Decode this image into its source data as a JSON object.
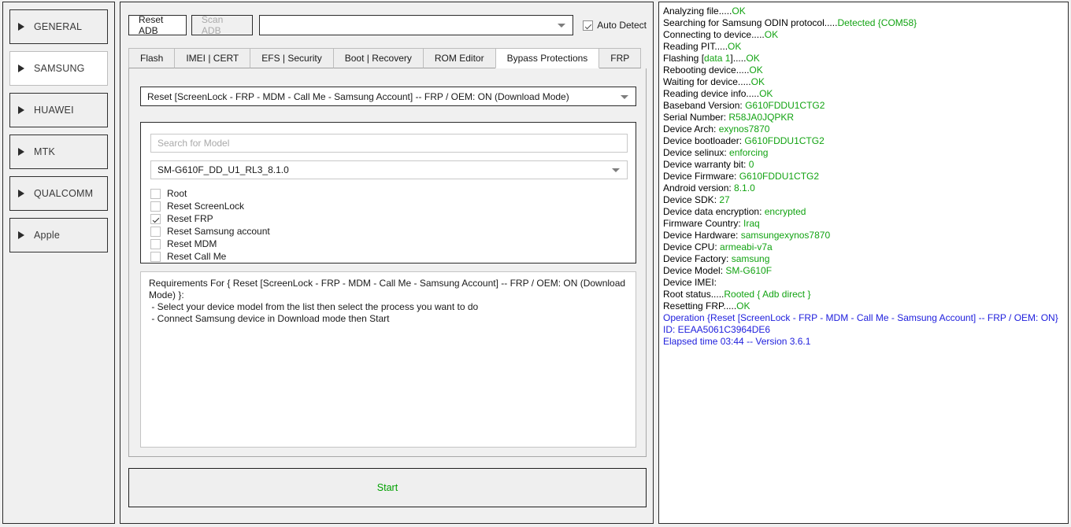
{
  "sidebar": {
    "items": [
      {
        "label": "GENERAL",
        "selected": false
      },
      {
        "label": "SAMSUNG",
        "selected": true
      },
      {
        "label": "HUAWEI",
        "selected": false
      },
      {
        "label": "MTK",
        "selected": false
      },
      {
        "label": "QUALCOMM",
        "selected": false
      },
      {
        "label": "Apple",
        "selected": false
      }
    ]
  },
  "toolbar": {
    "reset_adb_label": "Reset ADB",
    "scan_adb_label": "Scan ADB",
    "device_combo_value": "",
    "auto_detect_label": "Auto Detect",
    "auto_detect_checked": true
  },
  "tabs": [
    {
      "label": "Flash",
      "active": false
    },
    {
      "label": "IMEI | CERT",
      "active": false
    },
    {
      "label": "EFS | Security",
      "active": false
    },
    {
      "label": "Boot | Recovery",
      "active": false
    },
    {
      "label": "ROM Editor",
      "active": false
    },
    {
      "label": "Bypass Protections",
      "active": true
    },
    {
      "label": "FRP",
      "active": false
    }
  ],
  "panel": {
    "operation_value": "Reset [ScreenLock - FRP - MDM - Call Me - Samsung Account] -- FRP / OEM: ON (Download Mode)",
    "search_placeholder": "Search for Model",
    "search_value": "",
    "model_value": "SM-G610F_DD_U1_RL3_8.1.0",
    "options": [
      {
        "label": "Root",
        "checked": false
      },
      {
        "label": "Reset ScreenLock",
        "checked": false
      },
      {
        "label": "Reset FRP",
        "checked": true
      },
      {
        "label": "Reset Samsung account",
        "checked": false
      },
      {
        "label": "Reset MDM",
        "checked": false
      },
      {
        "label": "Reset Call Me",
        "checked": false
      }
    ],
    "requirements": "Requirements For { Reset [ScreenLock - FRP - MDM - Call Me - Samsung Account] -- FRP / OEM: ON (Download Mode) }:\n - Select your device model from the list then select the process you want to do\n - Connect Samsung device in Download mode then Start",
    "start_label": "Start"
  },
  "log": {
    "lines": [
      {
        "segs": [
          {
            "t": "Analyzing file.....",
            "c": "black"
          },
          {
            "t": "OK",
            "c": "green"
          }
        ]
      },
      {
        "segs": [
          {
            "t": "Searching for Samsung ODIN protocol.....",
            "c": "black"
          },
          {
            "t": "Detected {COM58}",
            "c": "green"
          }
        ]
      },
      {
        "segs": [
          {
            "t": "Connecting to device.....",
            "c": "black"
          },
          {
            "t": "OK",
            "c": "green"
          }
        ]
      },
      {
        "segs": [
          {
            "t": "Reading PIT.....",
            "c": "black"
          },
          {
            "t": "OK",
            "c": "green"
          }
        ]
      },
      {
        "segs": [
          {
            "t": "Flashing [",
            "c": "black"
          },
          {
            "t": "data 1",
            "c": "green"
          },
          {
            "t": "].....",
            "c": "black"
          },
          {
            "t": "OK",
            "c": "green"
          }
        ]
      },
      {
        "segs": [
          {
            "t": "Rebooting device.....",
            "c": "black"
          },
          {
            "t": "OK",
            "c": "green"
          }
        ]
      },
      {
        "segs": [
          {
            "t": "Waiting for device.....",
            "c": "black"
          },
          {
            "t": "OK",
            "c": "green"
          }
        ]
      },
      {
        "segs": [
          {
            "t": "Reading device info.....",
            "c": "black"
          },
          {
            "t": "OK",
            "c": "green"
          }
        ]
      },
      {
        "segs": [
          {
            "t": "Baseband Version: ",
            "c": "black"
          },
          {
            "t": "G610FDDU1CTG2",
            "c": "green"
          }
        ]
      },
      {
        "segs": [
          {
            "t": "Serial Number: ",
            "c": "black"
          },
          {
            "t": "R58JA0JQPKR",
            "c": "green"
          }
        ]
      },
      {
        "segs": [
          {
            "t": "Device Arch: ",
            "c": "black"
          },
          {
            "t": "exynos7870",
            "c": "green"
          }
        ]
      },
      {
        "segs": [
          {
            "t": "Device bootloader: ",
            "c": "black"
          },
          {
            "t": "G610FDDU1CTG2",
            "c": "green"
          }
        ]
      },
      {
        "segs": [
          {
            "t": "Device selinux: ",
            "c": "black"
          },
          {
            "t": "enforcing",
            "c": "green"
          }
        ]
      },
      {
        "segs": [
          {
            "t": "Device warranty bit: ",
            "c": "black"
          },
          {
            "t": "0",
            "c": "green"
          }
        ]
      },
      {
        "segs": [
          {
            "t": "Device Firmware: ",
            "c": "black"
          },
          {
            "t": "G610FDDU1CTG2",
            "c": "green"
          }
        ]
      },
      {
        "segs": [
          {
            "t": "Android version: ",
            "c": "black"
          },
          {
            "t": "8.1.0",
            "c": "green"
          }
        ]
      },
      {
        "segs": [
          {
            "t": "Device SDK: ",
            "c": "black"
          },
          {
            "t": "27",
            "c": "green"
          }
        ]
      },
      {
        "segs": [
          {
            "t": "Device data encryption: ",
            "c": "black"
          },
          {
            "t": "encrypted",
            "c": "green"
          }
        ]
      },
      {
        "segs": [
          {
            "t": "Firmware Country: ",
            "c": "black"
          },
          {
            "t": "Iraq",
            "c": "green"
          }
        ]
      },
      {
        "segs": [
          {
            "t": "Device Hardware: ",
            "c": "black"
          },
          {
            "t": "samsungexynos7870",
            "c": "green"
          }
        ]
      },
      {
        "segs": [
          {
            "t": "Device CPU: ",
            "c": "black"
          },
          {
            "t": "armeabi-v7a",
            "c": "green"
          }
        ]
      },
      {
        "segs": [
          {
            "t": "Device Factory: ",
            "c": "black"
          },
          {
            "t": "samsung",
            "c": "green"
          }
        ]
      },
      {
        "segs": [
          {
            "t": "Device Model: ",
            "c": "black"
          },
          {
            "t": "SM-G610F",
            "c": "green"
          }
        ]
      },
      {
        "segs": [
          {
            "t": "Device IMEI:",
            "c": "black"
          }
        ]
      },
      {
        "segs": [
          {
            "t": "Root status.....",
            "c": "black"
          },
          {
            "t": "Rooted { Adb direct }",
            "c": "green"
          }
        ]
      },
      {
        "segs": [
          {
            "t": "Resetting FRP.....",
            "c": "black"
          },
          {
            "t": "OK",
            "c": "green"
          }
        ]
      },
      {
        "segs": [
          {
            "t": "Operation {Reset [ScreenLock - FRP - MDM - Call Me - Samsung Account] -- FRP / OEM: ON}",
            "c": "blue"
          }
        ]
      },
      {
        "segs": [
          {
            "t": "ID: EEAA5061C3964DE6",
            "c": "blue"
          }
        ]
      },
      {
        "segs": [
          {
            "t": "Elapsed time 03:44 -- Version 3.6.1",
            "c": "blue"
          }
        ]
      }
    ]
  }
}
